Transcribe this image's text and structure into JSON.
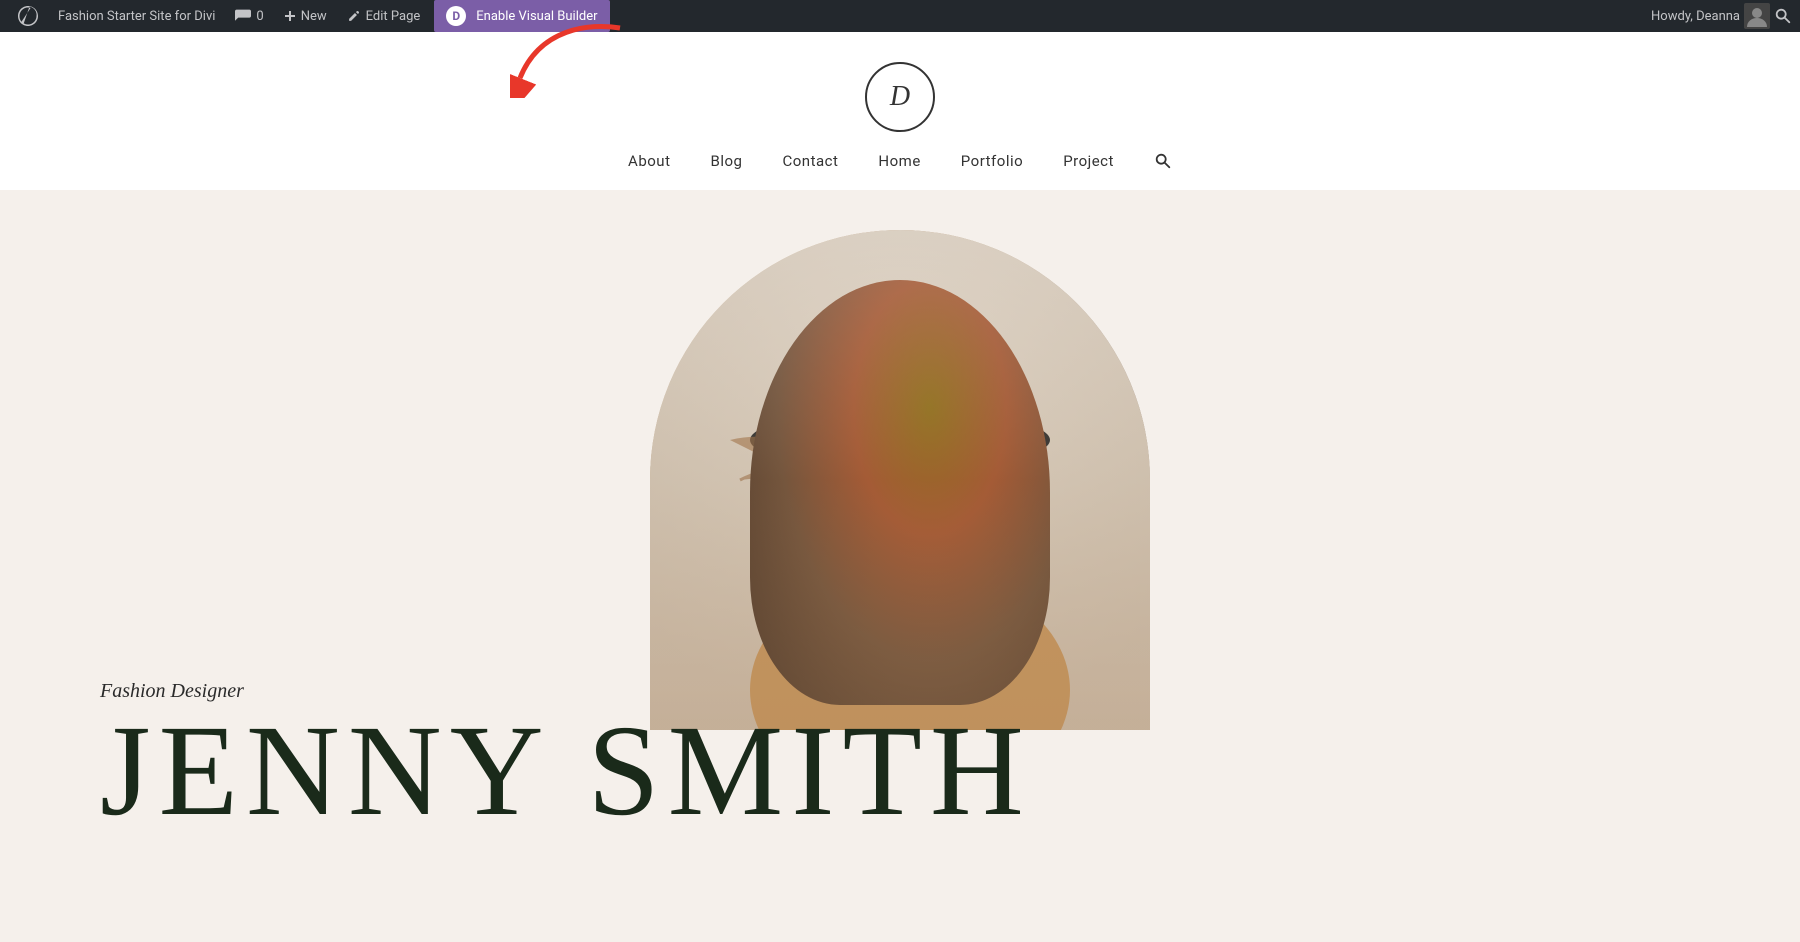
{
  "adminbar": {
    "site_name": "Fashion Starter Site for Divi",
    "comments_count": "0",
    "new_label": "New",
    "edit_page_label": "Edit Page",
    "enable_visual_builder_label": "Enable Visual Builder",
    "divi_letter": "D",
    "howdy_text": "Howdy, Deanna"
  },
  "site": {
    "logo_letter": "D",
    "nav_items": [
      {
        "label": "About"
      },
      {
        "label": "Blog"
      },
      {
        "label": "Contact"
      },
      {
        "label": "Home"
      },
      {
        "label": "Portfolio"
      },
      {
        "label": "Project"
      }
    ]
  },
  "hero": {
    "subtitle": "Fashion Designer",
    "name": "JENNY SMITH"
  },
  "colors": {
    "admin_bar_bg": "#23282d",
    "divi_purple": "#7b5ea7",
    "hero_bg": "#f5f0eb",
    "text_dark": "#1a2a1a"
  }
}
